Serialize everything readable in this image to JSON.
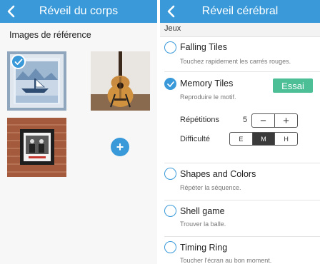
{
  "left": {
    "nav_title": "Réveil du corps",
    "section_title": "Images de référence",
    "images": [
      {
        "name": "Painting of a winter boat scene",
        "selected": true
      },
      {
        "name": "Acoustic guitar",
        "selected": false
      },
      {
        "name": "Framed photo on brick wall",
        "selected": false
      }
    ],
    "add_symbol": "+"
  },
  "right": {
    "nav_title": "Réveil cérébral",
    "group_header": "Jeux",
    "games": [
      {
        "name": "Falling Tiles",
        "description": "Touchez rapidement les carrés rouges.",
        "selected": false
      },
      {
        "name": "Memory Tiles",
        "description": "Reproduire le motif.",
        "selected": true
      },
      {
        "name": "Shapes and Colors",
        "description": "Répéter la séquence.",
        "selected": false
      },
      {
        "name": "Shell game",
        "description": "Trouver la balle.",
        "selected": false
      },
      {
        "name": "Timing Ring",
        "description": "Toucher l'écran au bon moment.",
        "selected": false
      }
    ],
    "try_label": "Essai",
    "repetitions": {
      "label": "Répétitions",
      "value": "5",
      "minus": "−",
      "plus": "+"
    },
    "difficulty": {
      "label": "Difficulté",
      "options": [
        "E",
        "M",
        "H"
      ],
      "selected": "M"
    }
  },
  "colors": {
    "accent": "#3a9ad9",
    "try_button": "#4cbf97"
  }
}
